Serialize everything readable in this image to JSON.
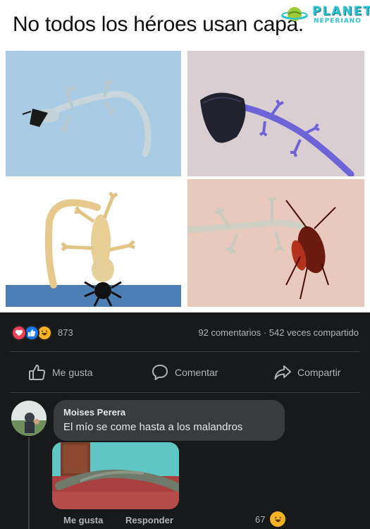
{
  "meme": {
    "title": "No todos los héroes usan capa.",
    "watermark_line1": "PLANETA",
    "watermark_line2": "NEPERIANO"
  },
  "post": {
    "reaction_count": "873",
    "comments_shares": "92 comentarios · 542 veces compartido",
    "reactions": [
      "love-icon",
      "like-icon",
      "haha-icon"
    ]
  },
  "actions": {
    "like_label": "Me gusta",
    "comment_label": "Comentar",
    "share_label": "Compartir"
  },
  "comment": {
    "author": "Moises Perera",
    "text": "El mío se come hasta a los malandros",
    "like_label": "Me gusta",
    "reply_label": "Responder",
    "reaction_count": "67",
    "reaction": "haha-icon"
  },
  "colors": {
    "background": "#18191a",
    "bubble": "#3a3b3c",
    "secondary_text": "#b0b3b8",
    "primary_text": "#e4e6eb",
    "like_blue": "#1877f2",
    "love_red": "#f33e58",
    "haha_yellow": "#f7b125",
    "watermark": "#2bc3d6"
  }
}
